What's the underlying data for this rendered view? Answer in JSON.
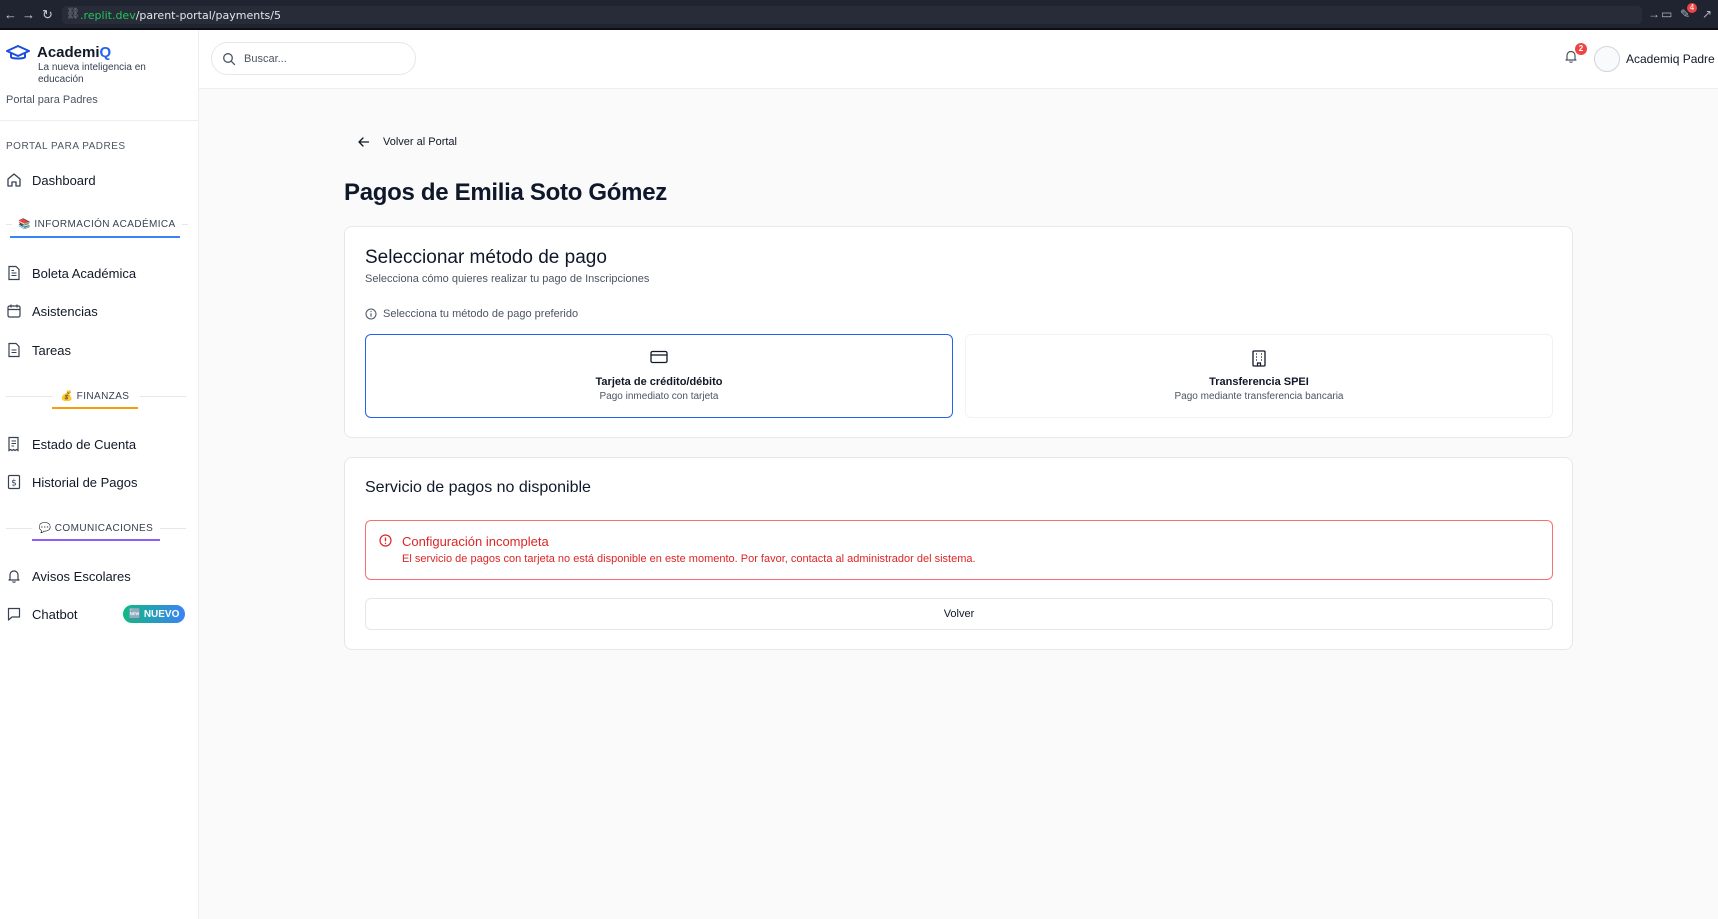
{
  "browser": {
    "url_domain": ".replit.dev",
    "url_path": "/parent-portal/payments/5",
    "badge": "4"
  },
  "brand": {
    "name_main": "Academi",
    "name_accent": "Q",
    "tagline": "La nueva inteligencia en educación",
    "portal_subtitle": "Portal para Padres"
  },
  "sidebar": {
    "section_label": "PORTAL PARA PADRES",
    "dashboard": "Dashboard",
    "group_academic": "📚 INFORMACIÓN ACADÉMICA",
    "boleta": "Boleta Académica",
    "asistencias": "Asistencias",
    "tareas": "Tareas",
    "group_finance": "💰 FINANZAS",
    "estado_cuenta": "Estado de Cuenta",
    "historial_pagos": "Historial de Pagos",
    "group_comms": "💬 COMUNICACIONES",
    "avisos": "Avisos Escolares",
    "chatbot": "Chatbot",
    "nuevo_badge": "🆕 NUEVO"
  },
  "header": {
    "search_placeholder": "Buscar...",
    "notification_count": "2",
    "user_name": "Academiq Padre"
  },
  "main": {
    "back_label": "Volver al Portal",
    "page_title": "Pagos de Emilia Soto Gómez",
    "method_card": {
      "title": "Seleccionar método de pago",
      "description": "Selecciona cómo quieres realizar tu pago de Inscripciones",
      "hint": "Selecciona tu método de pago preferido",
      "methods": [
        {
          "title": "Tarjeta de crédito/débito",
          "subtitle": "Pago inmediato con tarjeta",
          "icon": "credit-card-icon",
          "selected": true
        },
        {
          "title": "Transferencia SPEI",
          "subtitle": "Pago mediante transferencia bancaria",
          "icon": "building-icon",
          "selected": false
        }
      ]
    },
    "service_card": {
      "title": "Servicio de pagos no disponible",
      "alert_title": "Configuración incompleta",
      "alert_message": "El servicio de pagos con tarjeta no está disponible en este momento. Por favor, contacta al administrador del sistema.",
      "button": "Volver"
    }
  },
  "colors": {
    "accent": "#2563eb",
    "error": "#dc2626",
    "academic_underline": "#3b82f6",
    "finance_underline": "#f59e0b",
    "comms_underline": "#8b5cf6"
  }
}
